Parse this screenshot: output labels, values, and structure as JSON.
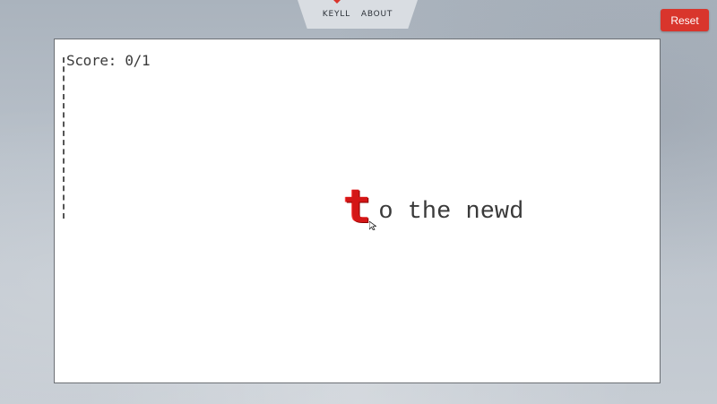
{
  "nav": {
    "links": [
      "KEYLL",
      "ABOUT"
    ]
  },
  "reset_button": {
    "label": "Reset",
    "color": "#d9352c"
  },
  "game": {
    "score_text": "Score: 0/1",
    "typed_text": "t",
    "remaining_text": "o the newd",
    "typed_color": "#d41616",
    "remaining_color": "#3a3a3a"
  }
}
